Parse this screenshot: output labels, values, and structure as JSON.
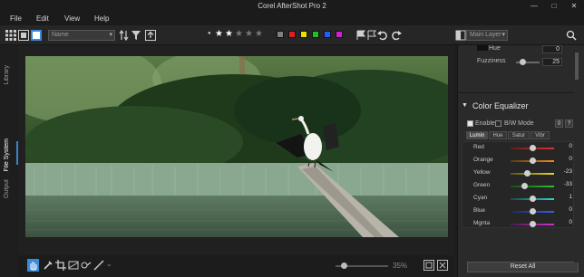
{
  "window": {
    "title": "Corel AfterShot Pro 2"
  },
  "menu": [
    "File",
    "Edit",
    "View",
    "Help"
  ],
  "toolbar": {
    "sort_dropdown": "Name",
    "rating_stars_filled": 2,
    "rating_stars_total": 5,
    "color_labels": [
      "#808080",
      "#e02020",
      "#e8e000",
      "#20c020",
      "#2060ff",
      "#d020d0"
    ],
    "layer_dropdown": "Main Layer"
  },
  "left_tabs": [
    "Library",
    "File System",
    "Output"
  ],
  "active_left_tab": "File System",
  "right_panel": {
    "hue_label": "Hue",
    "hue_value": "0",
    "fuzziness_label": "Fuzziness",
    "fuzziness_value": "25",
    "section_title": "Color Equalizer",
    "enable_label": "Enable",
    "bw_mode_label": "B/W Mode",
    "counter_value": "0",
    "help_glyph": "?",
    "tabs": [
      "Lumin",
      "Hue",
      "Satur",
      "Vibr"
    ],
    "active_tab": "Lumin",
    "equalizer": [
      {
        "name": "Red",
        "value": "0",
        "level": 0.5,
        "c1": "#5a2020",
        "c2": "#e03030"
      },
      {
        "name": "Orange",
        "value": "0",
        "level": 0.5,
        "c1": "#5a3a10",
        "c2": "#f08a20"
      },
      {
        "name": "Yellow",
        "value": "-23",
        "level": 0.38,
        "c1": "#55551a",
        "c2": "#e6d820"
      },
      {
        "name": "Green",
        "value": "-33",
        "level": 0.33,
        "c1": "#1a4a1a",
        "c2": "#30c030"
      },
      {
        "name": "Cyan",
        "value": "1",
        "level": 0.51,
        "c1": "#1a4a4a",
        "c2": "#30d0d0"
      },
      {
        "name": "Blue",
        "value": "0",
        "level": 0.5,
        "c1": "#1a2a5a",
        "c2": "#3060f0"
      },
      {
        "name": "Mgnta",
        "value": "0",
        "level": 0.5,
        "c1": "#4a1a4a",
        "c2": "#d030d0"
      }
    ],
    "reset_label": "Reset All"
  },
  "bottom": {
    "zoom_value": "35%",
    "zoom_level": 0.1
  }
}
